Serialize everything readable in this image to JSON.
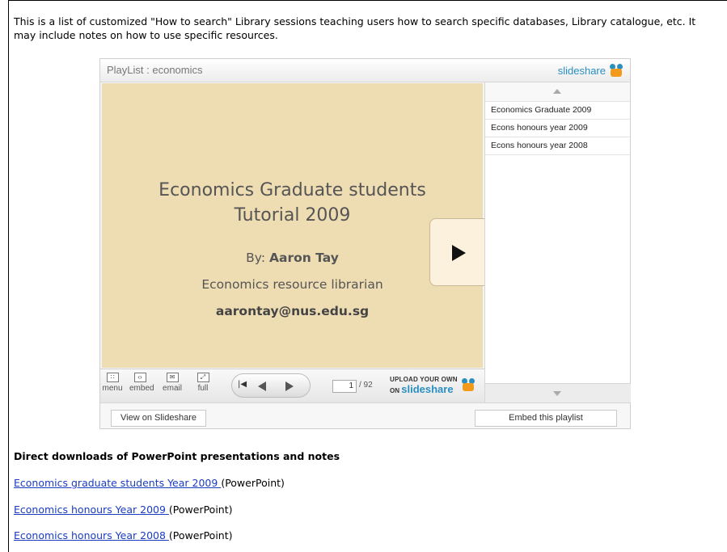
{
  "intro_text": "This is a list of customized \"How to search\" Library sessions teaching users how to search specific databases, Library catalogue, etc.  It may include notes on how to use specific resources.",
  "player": {
    "title": "PlayList : economics",
    "logo_text": "slideshare",
    "slide": {
      "title_line1": "Economics Graduate students",
      "title_line2": "Tutorial 2009",
      "by_label": "By: ",
      "author": "Aaron Tay",
      "role": "Economics resource librarian",
      "email": "aarontay@nus.edu.sg"
    },
    "playlist": [
      "Economics Graduate 2009",
      "Econs honours year 2009",
      "Econs honours year 2008"
    ],
    "controls": {
      "menu": "menu",
      "embed": "embed",
      "email": "email",
      "full": "full",
      "page_current": "1",
      "page_total": "/ 92",
      "upload_line1": "UPLOAD YOUR OWN",
      "upload_on": "ON",
      "upload_brand": "slideshare"
    },
    "footer": {
      "view_button": "View on Slideshare",
      "embed_button": "Embed this playlist"
    }
  },
  "downloads": {
    "heading": "Direct downloads of PowerPoint presentations and notes",
    "items": [
      {
        "link": "Economics graduate students Year 2009 ",
        "suffix": "(PowerPoint)"
      },
      {
        "link": "Economics honours Year 2009 ",
        "suffix": "(PowerPoint)"
      },
      {
        "link": "Economics honours Year 2008 ",
        "suffix": "(PowerPoint)"
      }
    ]
  },
  "colors": {
    "slide_bg": "#eedcb3",
    "link": "#1a3cbf",
    "brand_blue": "#2a8fc0",
    "brand_orange": "#f39a1a"
  }
}
